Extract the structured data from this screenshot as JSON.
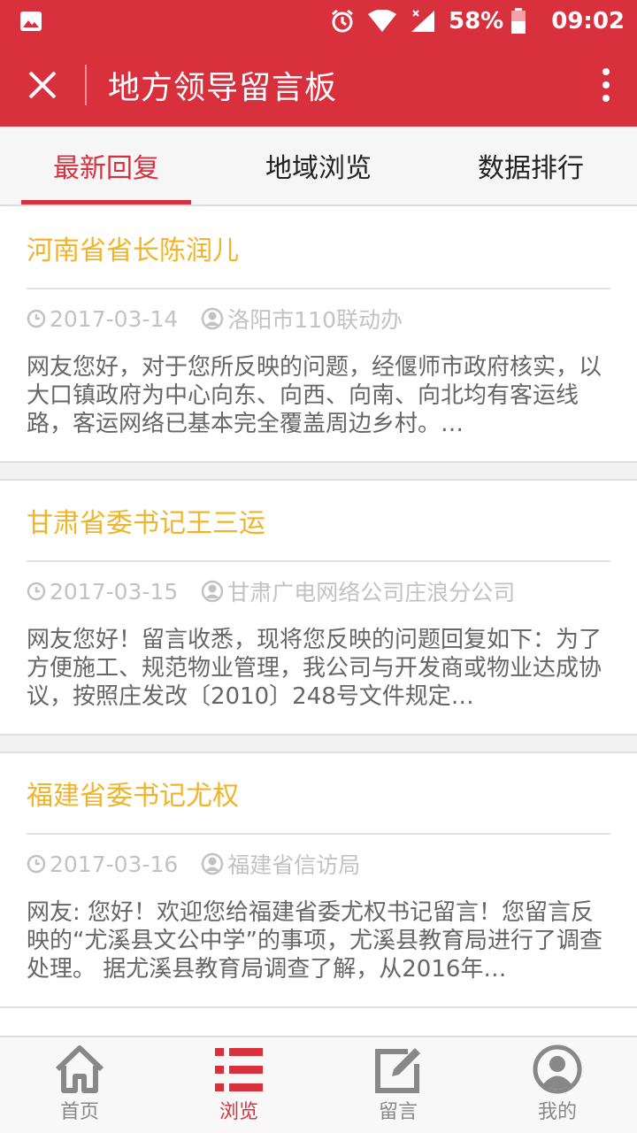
{
  "status_bar": {
    "battery": "58%",
    "time": "09:02",
    "icons": [
      "image-icon",
      "alarm-icon",
      "wifi-icon",
      "signal-icon",
      "battery-icon"
    ]
  },
  "app_bar": {
    "title": "地方领导留言板",
    "close_icon": "close-icon",
    "more_icon": "more-vertical-icon",
    "background": "#d9303e"
  },
  "tabs": [
    {
      "label": "最新回复",
      "active": true
    },
    {
      "label": "地域浏览",
      "active": false
    },
    {
      "label": "数据排行",
      "active": false
    }
  ],
  "messages": [
    {
      "title": "河南省省长陈润儿",
      "date": "2017-03-14",
      "responder": "洛阳市110联动办",
      "excerpt": "网友您好，对于您所反映的问题，经偃师市政府核实，以大口镇政府为中心向东、向西、向南、向北均有客运线路，客运网络已基本完全覆盖周边乡村。…"
    },
    {
      "title": "甘肃省委书记王三运",
      "date": "2017-03-15",
      "responder": "甘肃广电网络公司庄浪分公司",
      "excerpt": "网友您好！留言收悉，现将您反映的问题回复如下：为了方便施工、规范物业管理，我公司与开发商或物业达成协议，按照庄发改〔2010〕248号文件规定…"
    },
    {
      "title": "福建省委书记尤权",
      "date": "2017-03-16",
      "responder": "福建省信访局",
      "excerpt": "网友: 您好！欢迎您给福建省委尤权书记留言！您留言反映的“尤溪县文公中学”的事项，尤溪县教育局进行了调查处理。 据尤溪县教育局调查了解，从2016年…"
    }
  ],
  "bottom_nav": [
    {
      "label": "首页",
      "icon": "home-icon",
      "active": false
    },
    {
      "label": "浏览",
      "icon": "list-icon",
      "active": true
    },
    {
      "label": "留言",
      "icon": "edit-icon",
      "active": false
    },
    {
      "label": "我的",
      "icon": "user-icon",
      "active": false
    }
  ],
  "colors": {
    "accent": "#d9303e",
    "title_yellow": "#f0b429",
    "meta_gray": "#c2c2c2",
    "text_gray": "#666666"
  }
}
